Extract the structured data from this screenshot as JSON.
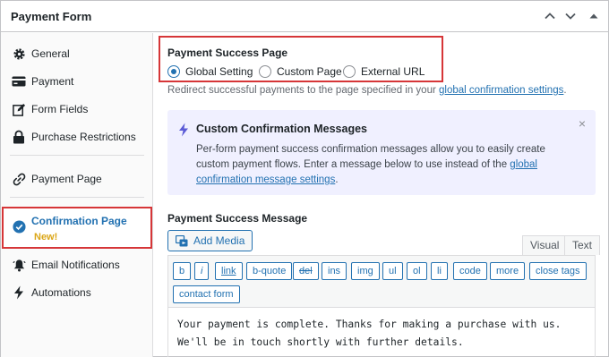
{
  "header": {
    "title": "Payment Form"
  },
  "sidebar": {
    "items": [
      {
        "label": "General",
        "icon": "gear-icon"
      },
      {
        "label": "Payment",
        "icon": "credit-card-icon"
      },
      {
        "label": "Form Fields",
        "icon": "edit-icon"
      },
      {
        "label": "Purchase Restrictions",
        "icon": "lock-icon"
      },
      {
        "label": "Payment Page",
        "icon": "link-icon"
      },
      {
        "label": "Confirmation Page",
        "icon": "check-circle-icon",
        "badge": "New!"
      },
      {
        "label": "Email Notifications",
        "icon": "bell-icon"
      },
      {
        "label": "Automations",
        "icon": "bolt-icon"
      }
    ]
  },
  "success_page": {
    "title": "Payment Success Page",
    "options": [
      "Global Setting",
      "Custom Page",
      "External URL"
    ],
    "selected": "Global Setting",
    "help_prefix": "Redirect successful payments to the page specified in your ",
    "help_link": "global confirmation settings",
    "help_suffix": "."
  },
  "notice": {
    "title": "Custom Confirmation Messages",
    "body_prefix": "Per-form payment success confirmation messages allow you to easily create custom payment flows. Enter a message below to use instead of the ",
    "body_link": "global confirmation message settings",
    "body_suffix": "."
  },
  "message": {
    "title": "Payment Success Message",
    "add_media": "Add Media",
    "tabs": [
      "Visual",
      "Text"
    ],
    "active_tab": "Text",
    "toolbar": [
      "b",
      "i",
      "link",
      "b-quote",
      "del",
      "ins",
      "img",
      "ul",
      "ol",
      "li",
      "code",
      "more",
      "close tags",
      "contact form"
    ],
    "content": "Your payment is complete. Thanks for making a purchase with us. We'll be in touch shortly with further details."
  },
  "colors": {
    "accent": "#2271b1",
    "highlight": "#d63638",
    "badge": "#dba617",
    "notice_bg": "#f0f0ff"
  }
}
